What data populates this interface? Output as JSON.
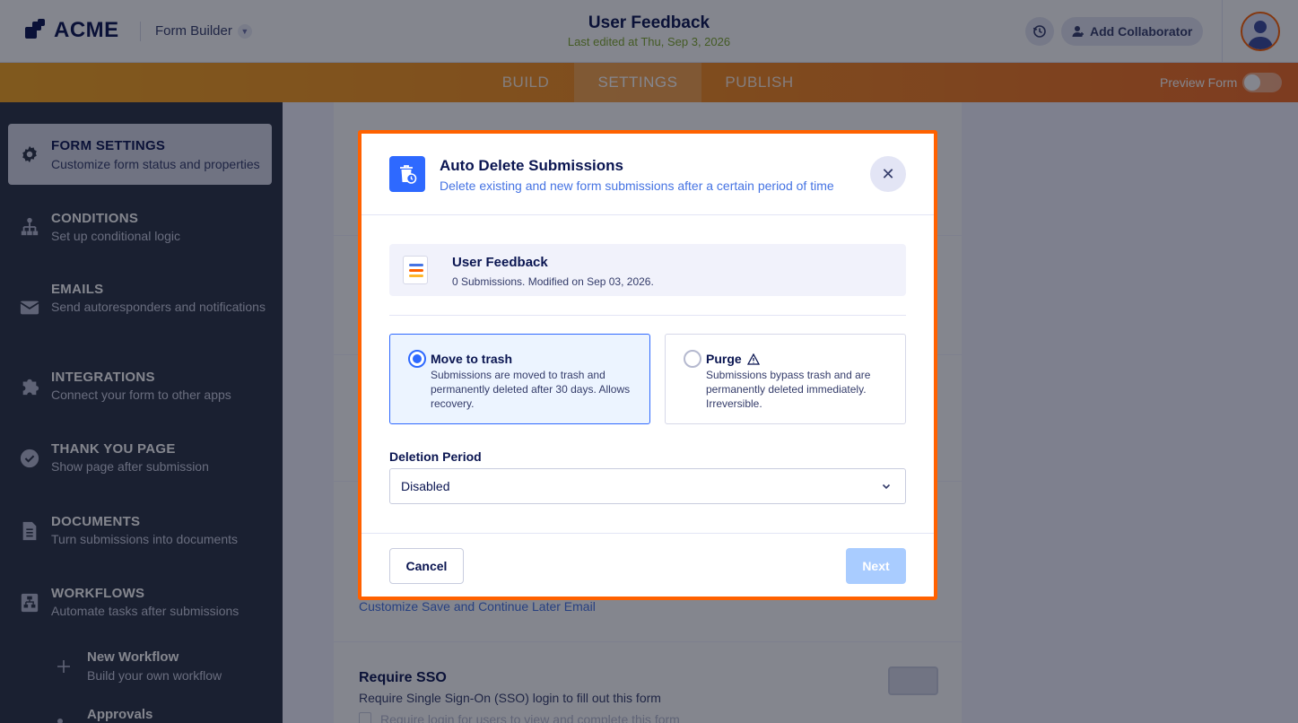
{
  "header": {
    "logo_text": "ACME",
    "app_name": "Form Builder",
    "form_title": "User Feedback",
    "last_edited": "Last edited at Thu, Sep 3, 2026",
    "add_collaborator_label": "Add Collaborator"
  },
  "tabs": [
    {
      "label": "BUILD",
      "active": false
    },
    {
      "label": "SETTINGS",
      "active": true
    },
    {
      "label": "PUBLISH",
      "active": false
    }
  ],
  "preview_form_label": "Preview Form",
  "sidebar": {
    "items": [
      {
        "title": "FORM SETTINGS",
        "subtitle": "Customize form status and properties",
        "icon": "gear-icon",
        "active": true
      },
      {
        "title": "CONDITIONS",
        "subtitle": "Set up conditional logic",
        "icon": "conditions-icon"
      },
      {
        "title": "EMAILS",
        "subtitle": "Send autoresponders and notifications",
        "icon": "envelope-icon"
      },
      {
        "title": "INTEGRATIONS",
        "subtitle": "Connect your form to other apps",
        "icon": "puzzle-icon"
      },
      {
        "title": "THANK YOU PAGE",
        "subtitle": "Show page after submission",
        "icon": "check-circle-icon"
      },
      {
        "title": "DOCUMENTS",
        "subtitle": "Turn submissions into documents",
        "icon": "document-icon"
      },
      {
        "title": "WORKFLOWS",
        "subtitle": "Automate tasks after submissions",
        "icon": "workflow-icon"
      }
    ],
    "subitems": [
      {
        "title": "New Workflow",
        "subtitle": "Build your own workflow",
        "icon": "plus-icon"
      },
      {
        "title": "Approvals",
        "icon": "approvals-icon"
      }
    ]
  },
  "background": {
    "link_text": "Customize Save and Continue Later Email",
    "sso_title": "Require SSO",
    "sso_subtitle": "Require Single Sign-On (SSO) login to fill out this form",
    "sso_checkbox": "Require login for users to view and complete this form"
  },
  "modal": {
    "title": "Auto Delete Submissions",
    "subtitle": "Delete existing and new form submissions after a certain period of time",
    "form_name": "User Feedback",
    "form_meta": "0 Submissions. Modified on Sep 03, 2026.",
    "options": [
      {
        "title": "Move to trash",
        "description": "Submissions are moved to trash and permanently deleted after 30 days. Allows recovery.",
        "selected": true
      },
      {
        "title": "Purge",
        "description": "Submissions bypass trash and are permanently deleted immediately. Irreversible.",
        "selected": false,
        "icon": "warning-icon"
      }
    ],
    "deletion_period_label": "Deletion Period",
    "deletion_period_value": "Disabled",
    "cancel_label": "Cancel",
    "next_label": "Next"
  },
  "colors": {
    "accent_orange": "#ff6100",
    "primary_blue": "#2e69ff",
    "sidebar_bg": "#2b3245"
  }
}
